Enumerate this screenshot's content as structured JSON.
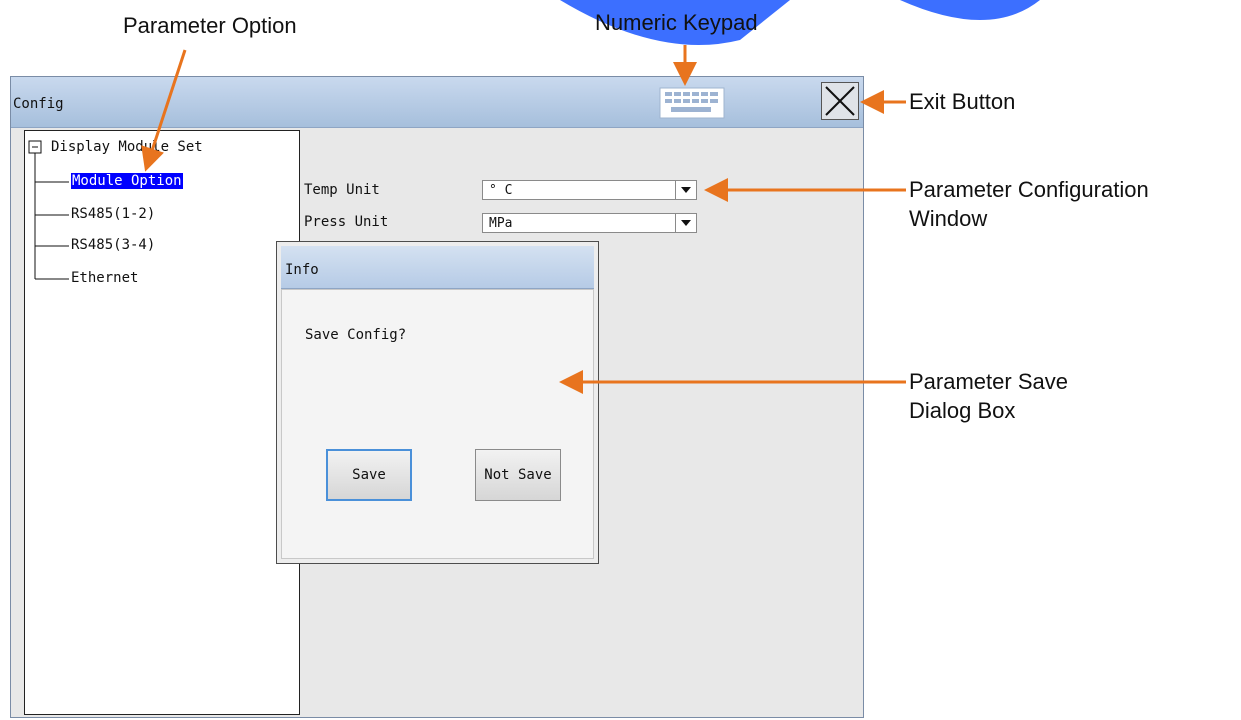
{
  "callouts": {
    "parameter_option": "Parameter Option",
    "numeric_keypad": "Numeric Keypad",
    "exit_button": "Exit Button",
    "param_config_line1": "Parameter Configuration",
    "param_config_line2": "Window",
    "param_save_line1": "Parameter  Save",
    "param_save_line2": "Dialog Box"
  },
  "window": {
    "title": "Config",
    "keypad_icon": "keyboard-icon",
    "close_icon": "close-icon"
  },
  "tree": {
    "root": "Display Module Set",
    "items": [
      "Module Option",
      "RS485(1-2)",
      "RS485(3-4)",
      "Ethernet"
    ],
    "selected": "Module Option"
  },
  "params": {
    "temp_label": "Temp Unit",
    "temp_value": "° C",
    "press_label": "Press Unit",
    "press_value": "MPa"
  },
  "dialog": {
    "title": "Info",
    "message": "Save Config?",
    "save_label": "Save",
    "not_save_label": "Not Save"
  },
  "colors": {
    "callout_arrow": "#e8741e",
    "selection": "#0000ff",
    "watermark": "#1a56ff"
  }
}
